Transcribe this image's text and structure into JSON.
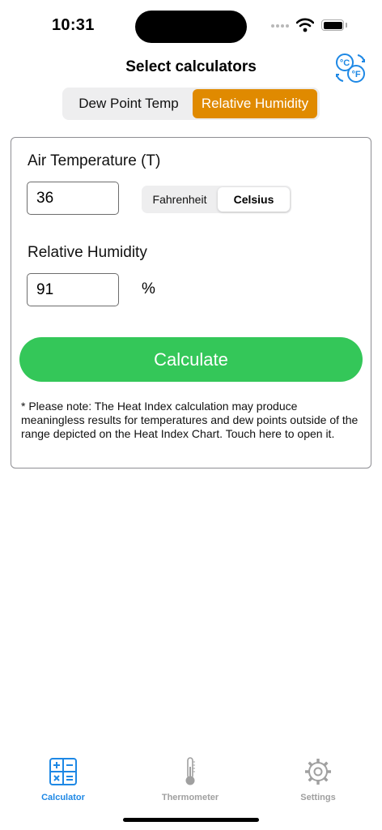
{
  "status": {
    "time": "10:31"
  },
  "header": {
    "title": "Select calculators"
  },
  "calculators": {
    "options": [
      "Dew Point Temp",
      "Relative Humidity"
    ],
    "selected": "Relative Humidity"
  },
  "form": {
    "air_temp_label": "Air Temperature (T)",
    "air_temp_value": "36",
    "temp_units": [
      "Fahrenheit",
      "Celsius"
    ],
    "selected_unit": "Celsius",
    "rh_label": "Relative Humidity",
    "rh_value": "91",
    "rh_unit": "%",
    "calculate_label": "Calculate",
    "note": "* Please note: The Heat Index calculation may produce meaningless results for temperatures and dew points outside of the range depicted on the Heat Index Chart. Touch here to open it."
  },
  "tabbar": {
    "items": [
      {
        "label": "Calculator",
        "icon": "calculator-icon",
        "active": true
      },
      {
        "label": "Thermometer",
        "icon": "thermometer-icon",
        "active": false
      },
      {
        "label": "Settings",
        "icon": "gear-icon",
        "active": false
      }
    ]
  },
  "colors": {
    "accent_orange": "#e08a00",
    "calculate_green": "#34c759",
    "active_tab_blue": "#1e88e5",
    "inactive_gray": "#a0a0a0"
  }
}
